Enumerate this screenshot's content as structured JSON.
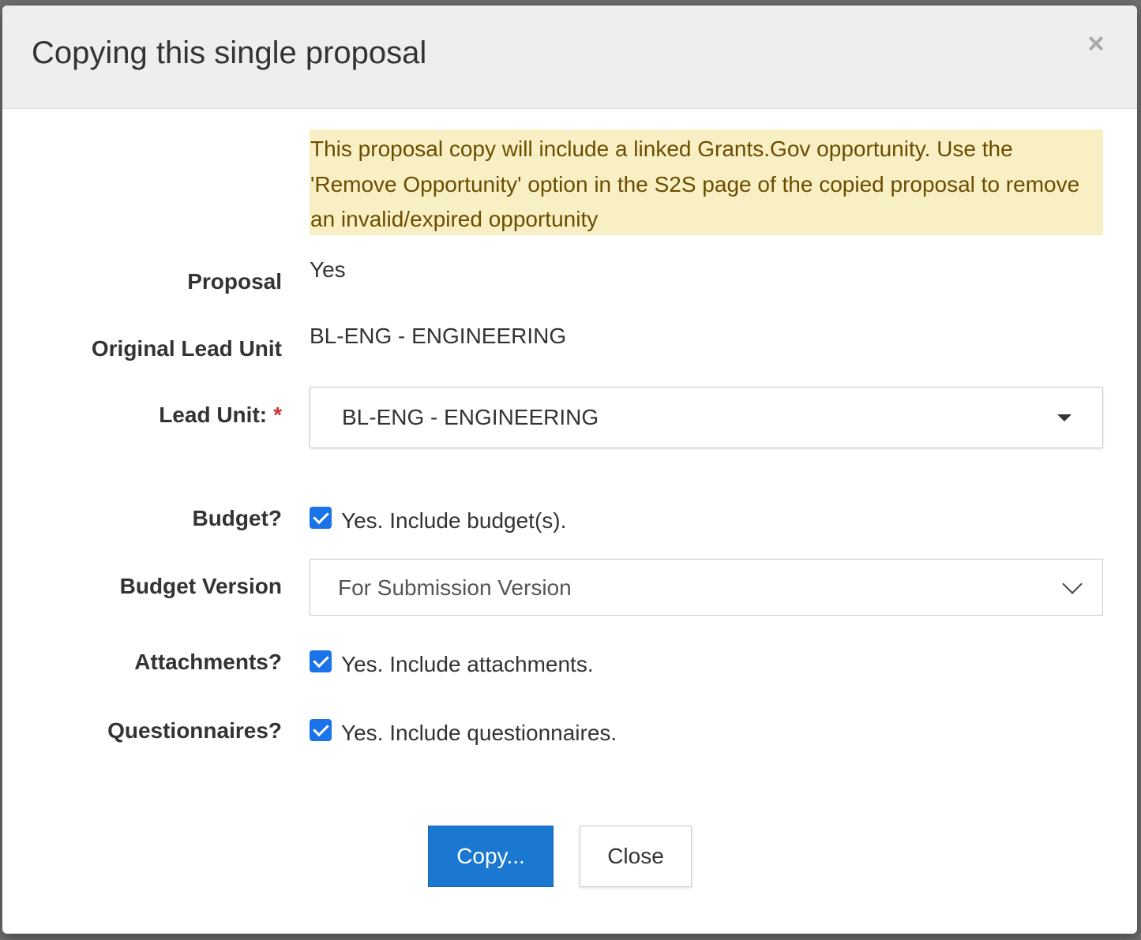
{
  "dialog": {
    "title": "Copying this single proposal",
    "warning_text": "This proposal copy will include a linked Grants.Gov opportunity. Use the 'Remove Opportunity' option in the S2S page of the copied proposal to remove an invalid/expired opportunity"
  },
  "form": {
    "proposal": {
      "label": "Proposal",
      "value": "Yes"
    },
    "original_lead_unit": {
      "label": "Original Lead Unit",
      "value": "BL-ENG - ENGINEERING"
    },
    "lead_unit": {
      "label": "Lead Unit:",
      "required_mark": "*",
      "selected": "BL-ENG - ENGINEERING"
    },
    "budget": {
      "label": "Budget?",
      "checked": true,
      "check_label": "Yes. Include budget(s)."
    },
    "budget_version": {
      "label": "Budget Version",
      "selected": "For Submission Version"
    },
    "attachments": {
      "label": "Attachments?",
      "checked": true,
      "check_label": "Yes. Include attachments."
    },
    "questionnaires": {
      "label": "Questionnaires?",
      "checked": true,
      "check_label": "Yes. Include questionnaires."
    }
  },
  "footer": {
    "copy_label": "Copy...",
    "close_label": "Close"
  },
  "icons": {
    "close": "close-icon",
    "lead_unit_dropdown": "caret-down-icon",
    "budget_version_dropdown": "chevron-down-icon",
    "checkbox": "checkmark-icon"
  },
  "colors": {
    "primary_button": "#1b78d0",
    "checkbox": "#1a73e8",
    "warning_background": "#f8efc4",
    "warning_text": "#6b4d00",
    "required": "#c9302c",
    "header_background": "#eeeeee"
  }
}
